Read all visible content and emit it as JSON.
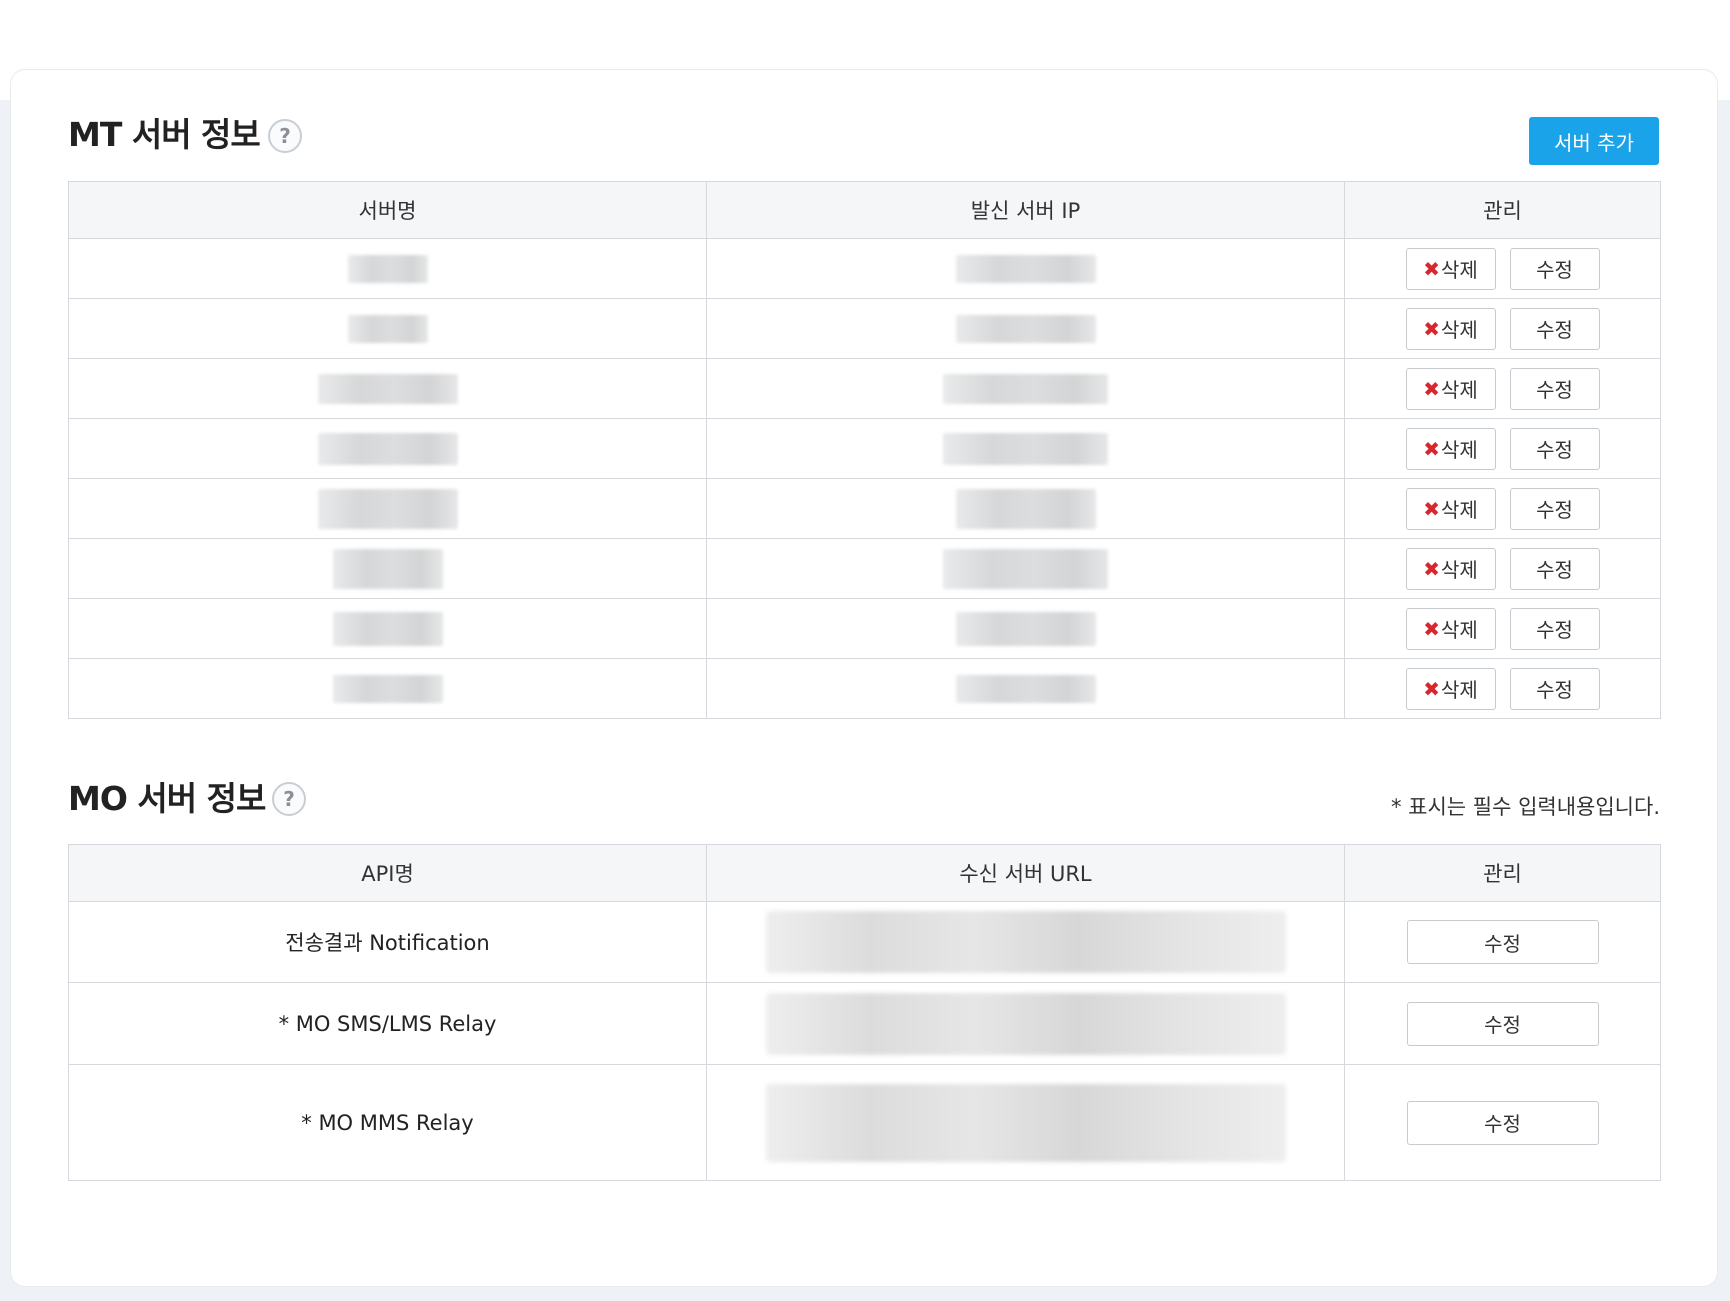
{
  "mt_section": {
    "title": "MT 서버 정보",
    "help": "?",
    "add_button": "서버 추가",
    "columns": [
      "서버명",
      "발신 서버 IP",
      "관리"
    ],
    "rows": [
      {
        "delete_label": "삭제",
        "edit_label": "수정"
      },
      {
        "delete_label": "삭제",
        "edit_label": "수정"
      },
      {
        "delete_label": "삭제",
        "edit_label": "수정"
      },
      {
        "delete_label": "삭제",
        "edit_label": "수정"
      },
      {
        "delete_label": "삭제",
        "edit_label": "수정"
      },
      {
        "delete_label": "삭제",
        "edit_label": "수정"
      },
      {
        "delete_label": "삭제",
        "edit_label": "수정"
      },
      {
        "delete_label": "삭제",
        "edit_label": "수정"
      }
    ],
    "delete_icon": "x-mark-icon",
    "delete_icon_color": "#d7262e"
  },
  "mo_section": {
    "title": "MO 서버 정보",
    "help": "?",
    "note": "* 표시는 필수 입력내용입니다.",
    "columns": [
      "API명",
      "수신 서버 URL",
      "관리"
    ],
    "rows": [
      {
        "api_name": "전송결과 Notification",
        "edit_label": "수정"
      },
      {
        "api_name": "* MO SMS/LMS Relay",
        "edit_label": "수정"
      },
      {
        "api_name": "* MO MMS Relay",
        "edit_label": "수정"
      }
    ]
  },
  "colors": {
    "accent": "#1aa3e8",
    "header_bg": "#f5f6f7",
    "border": "#d5d9dd"
  }
}
